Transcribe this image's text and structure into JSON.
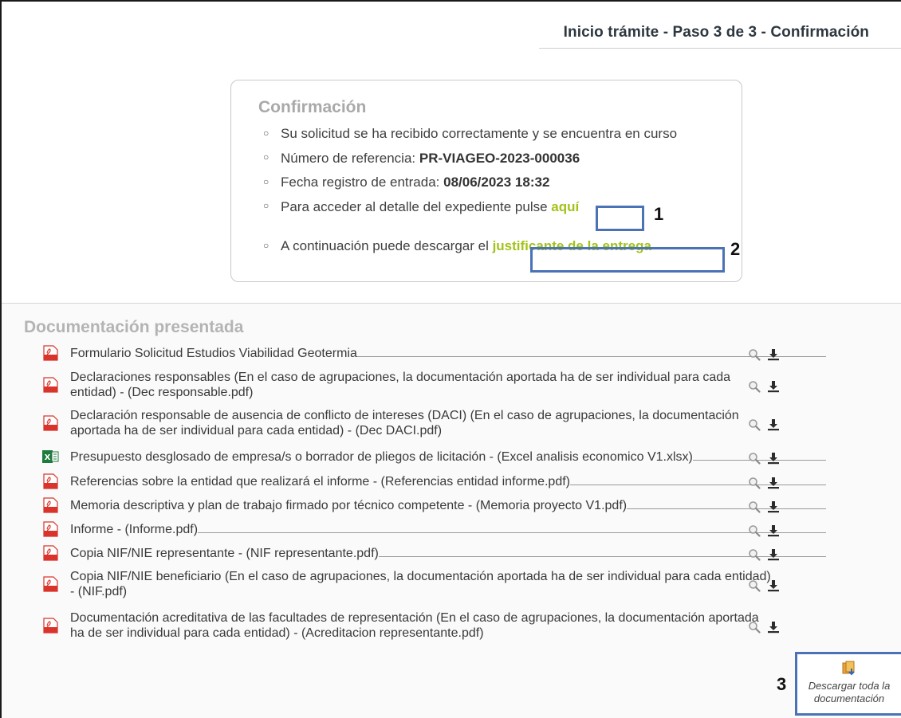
{
  "header": {
    "step_title": "Inicio trámite - Paso 3 de 3 - Confirmación"
  },
  "confirmation": {
    "title": "Confirmación",
    "line1": "Su solicitud se ha recibido correctamente y se encuentra en curso",
    "ref_label": "Número de referencia: ",
    "ref_value": "PR-VIAGEO-2023-000036",
    "date_label": "Fecha registro de entrada: ",
    "date_value": "08/06/2023 18:32",
    "detail_text": "Para acceder al detalle del expediente pulse ",
    "detail_link": "aquí",
    "download_text": "A continuación puede descargar el ",
    "download_link": "justificante de la entrega"
  },
  "annotations": {
    "n1": "1",
    "n2": "2",
    "n3": "3"
  },
  "documents": {
    "title": "Documentación presentada",
    "items": [
      {
        "type": "pdf",
        "label": "Formulario Solicitud Estudios Viabilidad Geotermia"
      },
      {
        "type": "pdf",
        "label": "Declaraciones responsables (En el caso de agrupaciones, la documentación aportada ha de ser individual para cada entidad) - (Dec responsable.pdf)"
      },
      {
        "type": "pdf",
        "label": "Declaración responsable de ausencia de conflicto de intereses (DACI) (En el caso de agrupaciones, la documentación aportada ha de ser individual para cada entidad) - (Dec DACI.pdf)"
      },
      {
        "type": "xlsx",
        "label": "Presupuesto desglosado de empresa/s o borrador de pliegos de licitación - (Excel analisis economico V1.xlsx)"
      },
      {
        "type": "pdf",
        "label": "Referencias sobre la entidad que realizará el informe - (Referencias entidad informe.pdf)"
      },
      {
        "type": "pdf",
        "label": "Memoria descriptiva y plan de trabajo firmado por técnico competente - (Memoria proyecto V1.pdf)"
      },
      {
        "type": "pdf",
        "label": "Informe - (Informe.pdf)"
      },
      {
        "type": "pdf",
        "label": "Copia NIF/NIE representante - (NIF representante.pdf)"
      },
      {
        "type": "pdf",
        "label": "Copia NIF/NIE beneficiario (En el caso de agrupaciones, la documentación aportada ha de ser individual para cada entidad) - (NIF.pdf)"
      },
      {
        "type": "pdf",
        "label": "Documentación acreditativa de las facultades de representación (En el caso de agrupaciones, la documentación aportada ha de ser individual para cada entidad) - (Acreditacion representante.pdf)"
      }
    ],
    "download_all_line1": "Descargar toda la",
    "download_all_line2": "documentación"
  },
  "colors": {
    "accent_link": "#a3c21a",
    "highlight_box": "#4a72b4",
    "pdf_red": "#d9342b",
    "excel_green": "#1f7a3e"
  }
}
